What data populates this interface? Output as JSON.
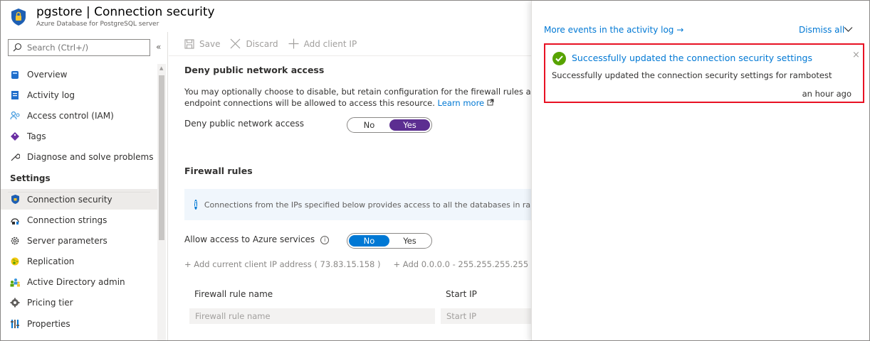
{
  "header": {
    "title": "pgstore | Connection security",
    "subtitle": "Azure Database for PostgreSQL server"
  },
  "sidebar": {
    "search_placeholder": "Search (Ctrl+/)",
    "collapse_label": "«",
    "items": [
      {
        "label": "Overview",
        "icon": "postgres-overview-icon"
      },
      {
        "label": "Activity log",
        "icon": "activity-log-icon"
      },
      {
        "label": "Access control (IAM)",
        "icon": "access-control-icon"
      },
      {
        "label": "Tags",
        "icon": "tag-icon"
      },
      {
        "label": "Diagnose and solve problems",
        "icon": "wrench-icon"
      }
    ],
    "section_label": "Settings",
    "settings_items": [
      {
        "label": "Connection security",
        "icon": "shield-icon",
        "active": true
      },
      {
        "label": "Connection strings",
        "icon": "connection-strings-icon"
      },
      {
        "label": "Server parameters",
        "icon": "gear-icon"
      },
      {
        "label": "Replication",
        "icon": "globe-icon"
      },
      {
        "label": "Active Directory admin",
        "icon": "users-icon"
      },
      {
        "label": "Pricing tier",
        "icon": "pricing-gear-icon"
      },
      {
        "label": "Properties",
        "icon": "properties-icon"
      }
    ]
  },
  "toolbar": {
    "save_label": "Save",
    "discard_label": "Discard",
    "add_client_ip_label": "Add client IP"
  },
  "main": {
    "deny_section_title": "Deny public network access",
    "description_line1": "You may optionally choose to disable, but retain configuration for the firewall rules and virtua",
    "description_line2": "endpoint connections will be allowed to access this resource.",
    "learn_more": "Learn more",
    "deny_label": "Deny public network access",
    "deny_toggle": {
      "no": "No",
      "yes": "Yes",
      "selected": "Yes"
    },
    "firewall_title": "Firewall rules",
    "info_text": "Connections from the IPs specified below provides access to all the databases in rambotest.",
    "allow_azure_label": "Allow access to Azure services",
    "allow_toggle": {
      "no": "No",
      "yes": "Yes",
      "selected": "No"
    },
    "add_current_ip": "+ Add current client IP address ( 73.83.15.158 )",
    "add_range": "+ Add 0.0.0.0 - 255.255.255.255",
    "columns": [
      "Firewall rule name",
      "Start IP"
    ],
    "rule_name_placeholder": "Firewall rule name",
    "start_ip_placeholder": "Start IP"
  },
  "notifications": {
    "more_events": "More events in the activity log →",
    "dismiss_all": "Dismiss all",
    "card": {
      "title": "Successfully updated the connection security settings",
      "body": "Successfully updated the connection security settings for rambotest",
      "time": "an hour ago",
      "close": "×"
    }
  },
  "colors": {
    "accent": "#0078d4",
    "toggle_purple": "#5c2e91",
    "success": "#57a300",
    "highlight_border": "#e81123"
  }
}
